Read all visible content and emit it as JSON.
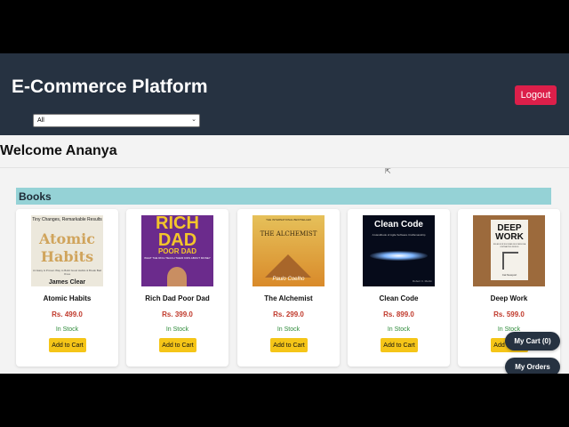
{
  "header": {
    "title": "E-Commerce Platform",
    "logout_label": "Logout"
  },
  "filter": {
    "selected": "All"
  },
  "welcome": "Welcome Ananya",
  "section": {
    "title": "Books"
  },
  "products": [
    {
      "title": "Atomic Habits",
      "price": "Rs. 499.0",
      "stock": "In Stock",
      "button": "Add to Cart",
      "cover": {
        "tagline": "Tiny Changes, Remarkable Results",
        "title": "Atomic Habits",
        "subtitle": "An Easy & Proven Way to Build Good Habits & Break Bad Ones",
        "author": "James Clear"
      }
    },
    {
      "title": "Rich Dad Poor Dad",
      "price": "Rs. 399.0",
      "stock": "In Stock",
      "button": "Add to Cart",
      "cover": {
        "line1": "RICH DAD",
        "line2": "POOR DAD",
        "tagline": "WHAT THE RICH TEACH THEIR KIDS ABOUT MONEY"
      }
    },
    {
      "title": "The Alchemist",
      "price": "Rs. 299.0",
      "stock": "In Stock",
      "button": "Add to Cart",
      "cover": {
        "top": "THE INTERNATIONAL BESTSELLER",
        "title": "THE ALCHEMIST",
        "author": "Paulo Coelho"
      }
    },
    {
      "title": "Clean Code",
      "price": "Rs. 899.0",
      "stock": "In Stock",
      "button": "Add to Cart",
      "cover": {
        "title": "Clean Code",
        "subtitle": "A Handbook of Agile Software Craftsmanship",
        "author": "Robert C. Martin"
      }
    },
    {
      "title": "Deep Work",
      "price": "Rs. 599.0",
      "stock": "In Stock",
      "button": "Add to Cart",
      "cover": {
        "title": "DEEP WORK",
        "subtitle": "RULES FOR FOCUSED SUCCESS IN A DISTRACTED WORLD",
        "author": "Cal Newport"
      }
    }
  ],
  "floating": {
    "cart_label": "My Cart (0)",
    "orders_label": "My Orders"
  },
  "colors": {
    "header_bg": "#263241",
    "logout_bg": "#dc1f4a",
    "section_bg": "#95d2d6",
    "price": "#c0392b",
    "stock": "#2e8b3a",
    "add_to_cart_bg": "#f5c518"
  }
}
